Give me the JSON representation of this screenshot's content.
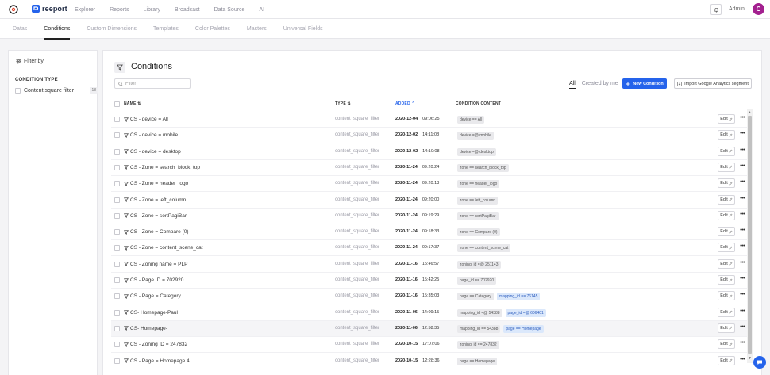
{
  "nav": {
    "brand": "reeport",
    "items": [
      "Explorer",
      "Reports",
      "Library",
      "Broadcast",
      "Data Source",
      "AI"
    ],
    "user_label": "Admin",
    "avatar_initial": "C"
  },
  "subnav": {
    "items": [
      "Datas",
      "Conditions",
      "Custom Dimensions",
      "Templates",
      "Color Palettes",
      "Masters",
      "Universal Fields"
    ],
    "active": "Conditions"
  },
  "sidebar": {
    "title": "Filter by",
    "section_title": "CONDITION TYPE",
    "options": [
      {
        "label": "Content square filter",
        "count": "18"
      }
    ]
  },
  "main": {
    "title": "Conditions",
    "search_placeholder": "Filter",
    "tabs": [
      "All",
      "Created by me"
    ],
    "active_tab": "All",
    "new_button": "New Condition",
    "import_button": "Import Google Analytics segment",
    "columns": {
      "name": "NAME",
      "type": "TYPE",
      "added": "ADDED",
      "content": "CONDITION CONTENT"
    },
    "edit_label": "Edit",
    "more_label": "•••",
    "rows": [
      {
        "name": "CS - device = All",
        "type": "content_square_filter",
        "date": "2020-12-04",
        "time": "09:06:25",
        "chips": [
          {
            "text": "device == All",
            "style": "gray"
          }
        ]
      },
      {
        "name": "CS - device = mobile",
        "type": "content_square_filter",
        "date": "2020-12-02",
        "time": "14:11:08",
        "chips": [
          {
            "text": "device =@ mobile",
            "style": "gray"
          }
        ]
      },
      {
        "name": "CS - device = desktop",
        "type": "content_square_filter",
        "date": "2020-12-02",
        "time": "14:10:08",
        "chips": [
          {
            "text": "device =@ desktop",
            "style": "gray"
          }
        ]
      },
      {
        "name": "CS - Zone = search_block_top",
        "type": "content_square_filter",
        "date": "2020-11-24",
        "time": "09:20:24",
        "chips": [
          {
            "text": "zone == search_block_top",
            "style": "gray"
          }
        ]
      },
      {
        "name": "CS - Zone = header_logo",
        "type": "content_square_filter",
        "date": "2020-11-24",
        "time": "09:20:13",
        "chips": [
          {
            "text": "zone == header_logo",
            "style": "gray"
          }
        ]
      },
      {
        "name": "CS - Zone = left_column",
        "type": "content_square_filter",
        "date": "2020-11-24",
        "time": "09:20:00",
        "chips": [
          {
            "text": "zone == left_column",
            "style": "gray"
          }
        ]
      },
      {
        "name": "CS - Zone = sortPagiBar",
        "type": "content_square_filter",
        "date": "2020-11-24",
        "time": "09:19:29",
        "chips": [
          {
            "text": "zone == sortPagiBar",
            "style": "gray"
          }
        ]
      },
      {
        "name": "CS - Zone = Compare (0)",
        "type": "content_square_filter",
        "date": "2020-11-24",
        "time": "09:18:33",
        "chips": [
          {
            "text": "zone == Compare (0)",
            "style": "gray"
          }
        ]
      },
      {
        "name": "CS - Zone = content_scene_cat",
        "type": "content_square_filter",
        "date": "2020-11-24",
        "time": "09:17:37",
        "chips": [
          {
            "text": "zone == content_scene_cat",
            "style": "gray"
          }
        ]
      },
      {
        "name": "CS - Zoning name = PLP",
        "type": "content_square_filter",
        "date": "2020-11-16",
        "time": "15:46:57",
        "chips": [
          {
            "text": "zoning_id =@ 251143",
            "style": "gray"
          }
        ]
      },
      {
        "name": "CS - Page ID = 702920",
        "type": "content_square_filter",
        "date": "2020-11-16",
        "time": "15:42:25",
        "chips": [
          {
            "text": "page_id == 702920",
            "style": "gray"
          }
        ]
      },
      {
        "name": "CS - Page = Category",
        "type": "content_square_filter",
        "date": "2020-11-16",
        "time": "15:35:03",
        "chips": [
          {
            "text": "page == Category",
            "style": "gray"
          },
          {
            "text": "mapping_id == 76145",
            "style": "blue"
          }
        ]
      },
      {
        "name": "CS- Homepage-Paul",
        "type": "content_square_filter",
        "date": "2020-11-06",
        "time": "14:09:15",
        "chips": [
          {
            "text": "mapping_id =@ 54388",
            "style": "gray"
          },
          {
            "text": "page_id =@ 606401",
            "style": "blue"
          }
        ]
      },
      {
        "name": "CS- Homepage-",
        "type": "content_square_filter",
        "date": "2020-11-06",
        "time": "12:58:35",
        "chips": [
          {
            "text": "mapping_id == 54388",
            "style": "gray"
          },
          {
            "text": "page == Homepage",
            "style": "blue"
          }
        ]
      },
      {
        "name": "CS - Zoning ID = 247832",
        "type": "content_square_filter",
        "date": "2020-10-15",
        "time": "17:07:06",
        "chips": [
          {
            "text": "zoning_id == 247832",
            "style": "gray"
          }
        ]
      },
      {
        "name": "CS - Page = Homepage 4",
        "type": "content_square_filter",
        "date": "2020-10-15",
        "time": "12:28:36",
        "chips": [
          {
            "text": "page == Homepage",
            "style": "gray"
          }
        ]
      }
    ]
  },
  "colors": {
    "accent": "#2563eb",
    "avatar": "#a3208f",
    "chip_blue_bg": "#dbe8fb",
    "chip_gray_bg": "#e9e9ec"
  }
}
